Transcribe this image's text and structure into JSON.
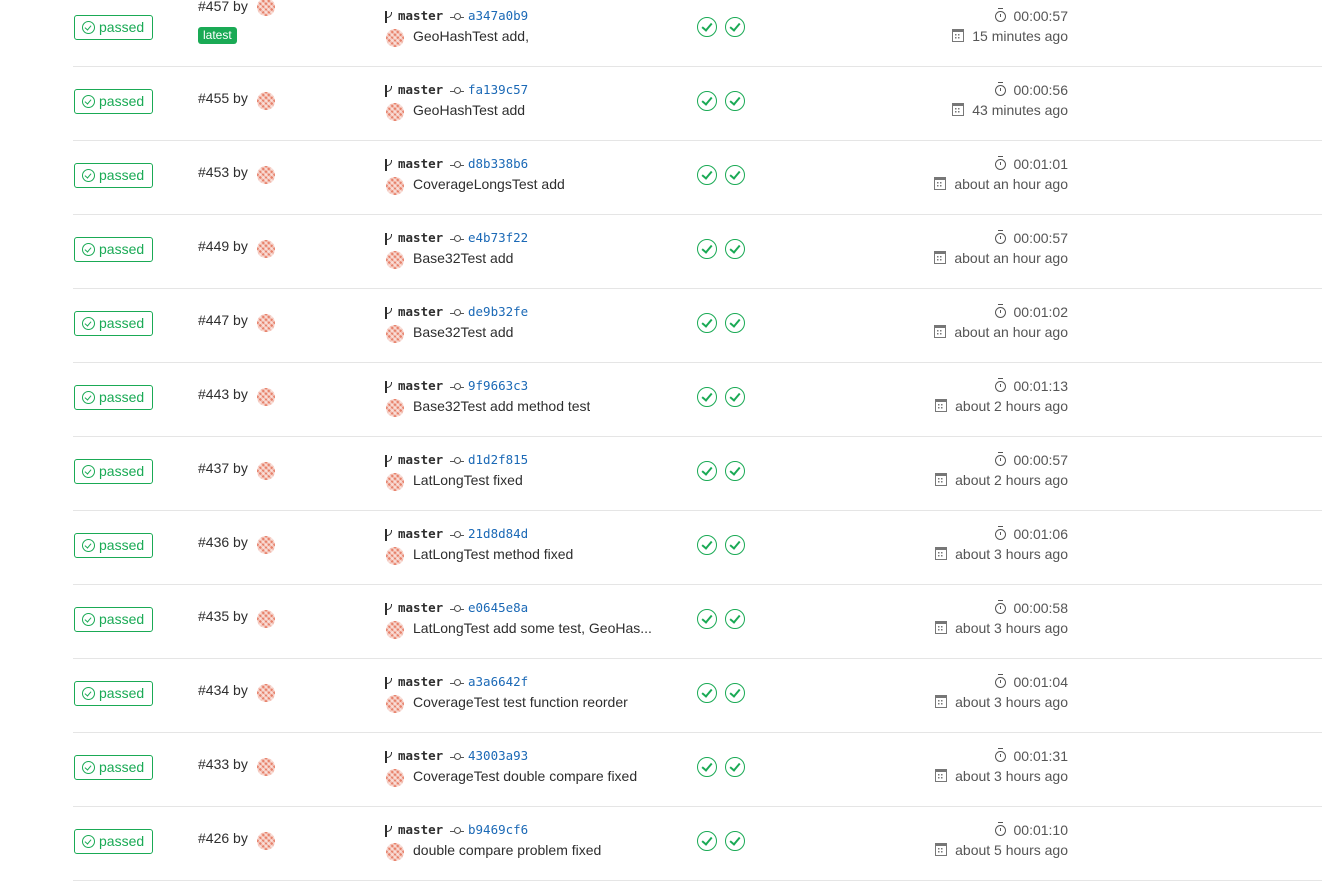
{
  "pipelines": [
    {
      "status": "passed",
      "id": "#457 by",
      "latest": "latest",
      "branch": "master",
      "sha": "a347a0b9",
      "message": "GeoHashTest add,",
      "duration": "00:00:57",
      "finished": "15 minutes ago",
      "stages": [
        "passed",
        "passed"
      ]
    },
    {
      "status": "passed",
      "id": "#455 by",
      "branch": "master",
      "sha": "fa139c57",
      "message": "GeoHashTest add",
      "duration": "00:00:56",
      "finished": "43 minutes ago",
      "stages": [
        "passed",
        "passed"
      ]
    },
    {
      "status": "passed",
      "id": "#453 by",
      "branch": "master",
      "sha": "d8b338b6",
      "message": "CoverageLongsTest add",
      "duration": "00:01:01",
      "finished": "about an hour ago",
      "stages": [
        "passed",
        "passed"
      ]
    },
    {
      "status": "passed",
      "id": "#449 by",
      "branch": "master",
      "sha": "e4b73f22",
      "message": "Base32Test add",
      "duration": "00:00:57",
      "finished": "about an hour ago",
      "stages": [
        "passed",
        "passed"
      ]
    },
    {
      "status": "passed",
      "id": "#447 by",
      "branch": "master",
      "sha": "de9b32fe",
      "message": "Base32Test add",
      "duration": "00:01:02",
      "finished": "about an hour ago",
      "stages": [
        "passed",
        "passed"
      ]
    },
    {
      "status": "passed",
      "id": "#443 by",
      "branch": "master",
      "sha": "9f9663c3",
      "message": "Base32Test add method test",
      "duration": "00:01:13",
      "finished": "about 2 hours ago",
      "stages": [
        "passed",
        "passed"
      ]
    },
    {
      "status": "passed",
      "id": "#437 by",
      "branch": "master",
      "sha": "d1d2f815",
      "message": "LatLongTest fixed",
      "duration": "00:00:57",
      "finished": "about 2 hours ago",
      "stages": [
        "passed",
        "passed"
      ]
    },
    {
      "status": "passed",
      "id": "#436 by",
      "branch": "master",
      "sha": "21d8d84d",
      "message": "LatLongTest method fixed",
      "duration": "00:01:06",
      "finished": "about 3 hours ago",
      "stages": [
        "passed",
        "passed"
      ]
    },
    {
      "status": "passed",
      "id": "#435 by",
      "branch": "master",
      "sha": "e0645e8a",
      "message": "LatLongTest add some test, GeoHas...",
      "duration": "00:00:58",
      "finished": "about 3 hours ago",
      "stages": [
        "passed",
        "passed"
      ]
    },
    {
      "status": "passed",
      "id": "#434 by",
      "branch": "master",
      "sha": "a3a6642f",
      "message": "CoverageTest test function reorder",
      "duration": "00:01:04",
      "finished": "about 3 hours ago",
      "stages": [
        "passed",
        "passed"
      ]
    },
    {
      "status": "passed",
      "id": "#433 by",
      "branch": "master",
      "sha": "43003a93",
      "message": "CoverageTest double compare fixed",
      "duration": "00:01:31",
      "finished": "about 3 hours ago",
      "stages": [
        "passed",
        "passed"
      ]
    },
    {
      "status": "passed",
      "id": "#426 by",
      "branch": "master",
      "sha": "b9469cf6",
      "message": "double compare problem fixed",
      "duration": "00:01:10",
      "finished": "about 5 hours ago",
      "stages": [
        "passed",
        "passed"
      ]
    }
  ],
  "colors": {
    "success": "#1aaa55",
    "link": "#1b69b6",
    "text": "#2e2e2e",
    "muted": "#555555",
    "border": "#e5e5e5"
  },
  "icons": {
    "status": "check-circle-icon",
    "branch": "branch-icon",
    "commit": "commit-icon",
    "duration": "timer-icon",
    "finished": "calendar-icon",
    "stage": "stage-passed-icon"
  }
}
